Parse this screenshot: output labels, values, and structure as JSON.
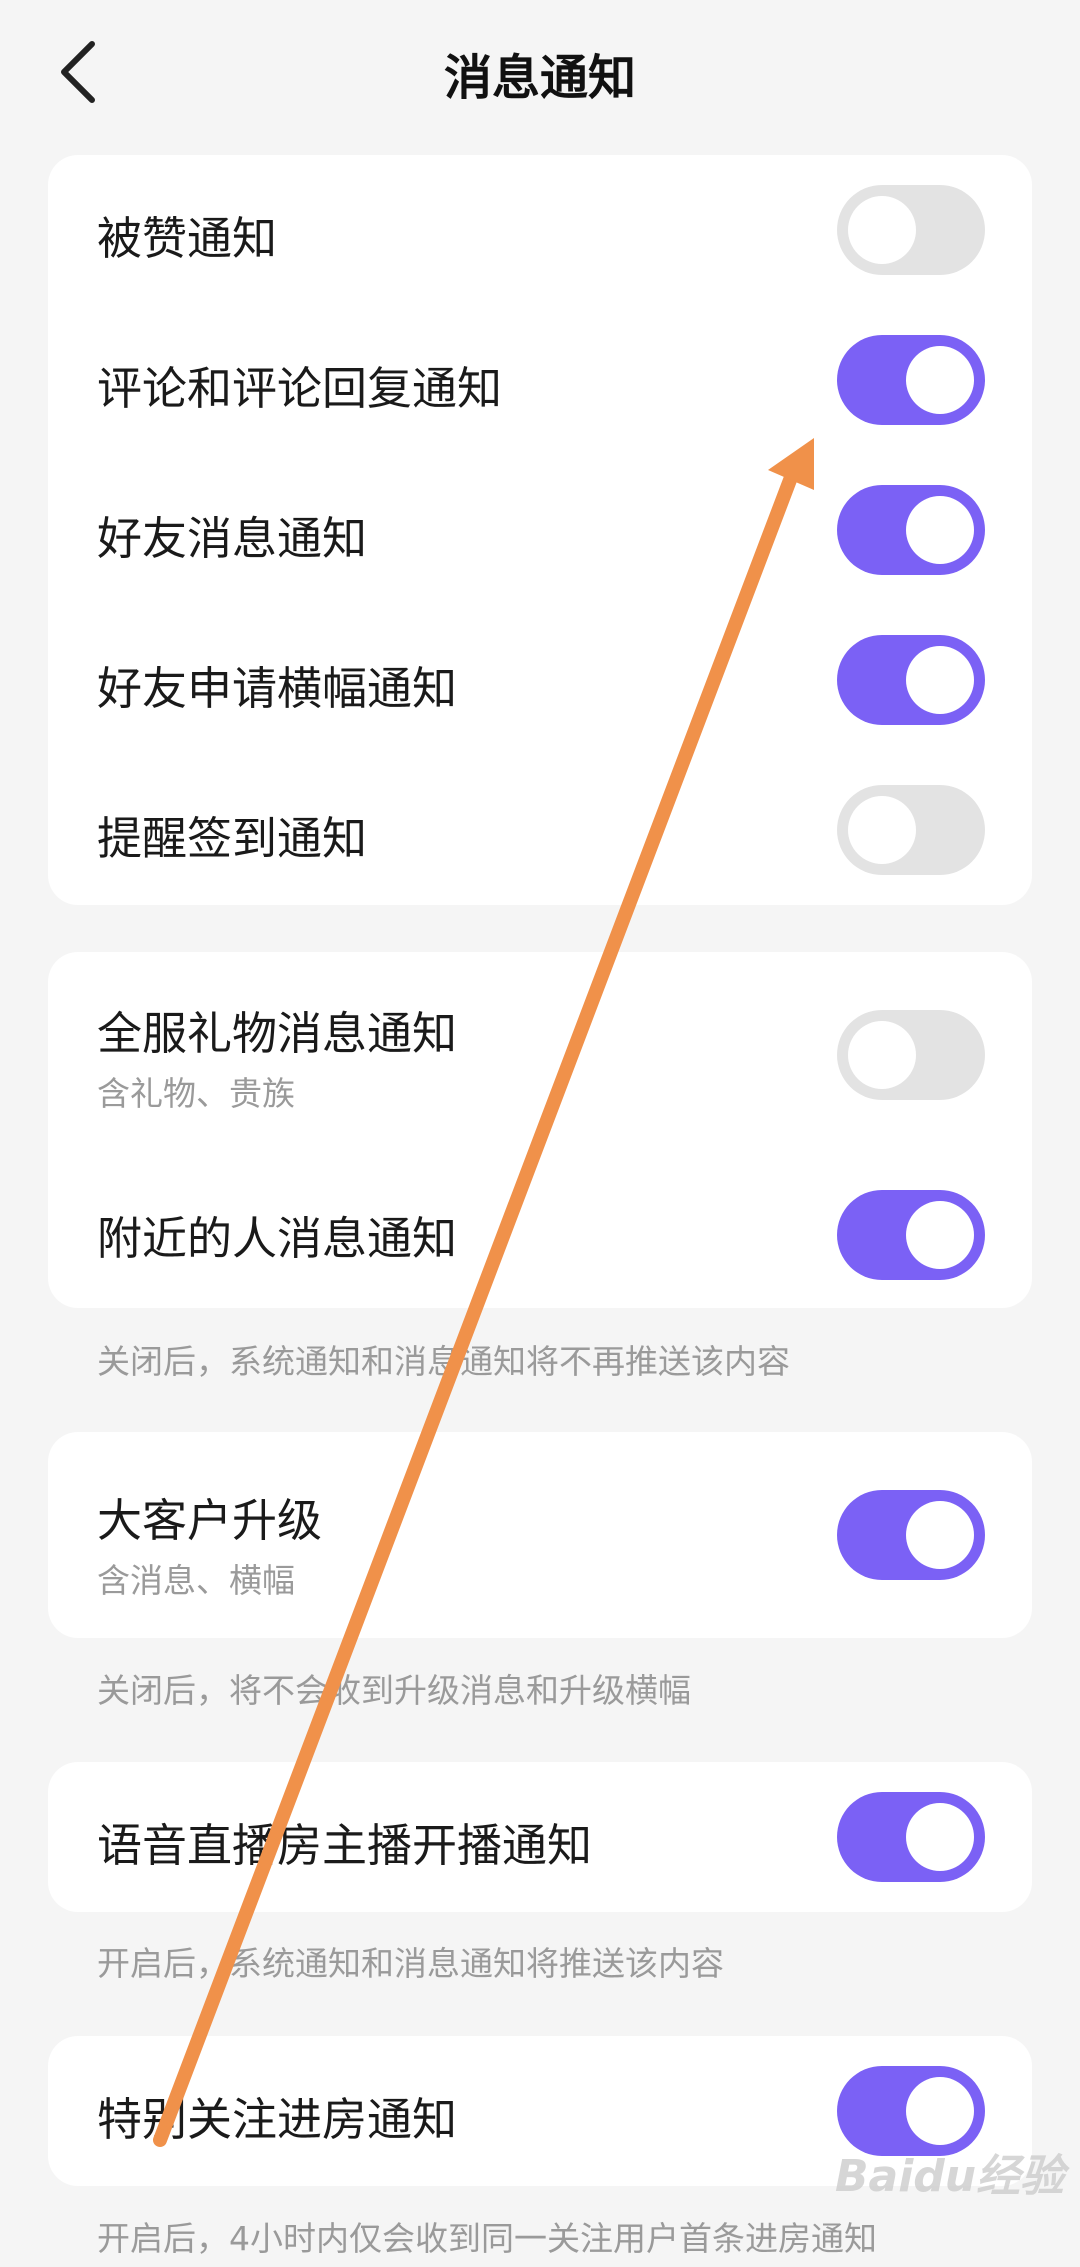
{
  "header": {
    "title": "消息通知"
  },
  "group1": {
    "items": [
      {
        "label": "被赞通知",
        "on": false
      },
      {
        "label": "评论和评论回复通知",
        "on": true
      },
      {
        "label": "好友消息通知",
        "on": true
      },
      {
        "label": "好友申请横幅通知",
        "on": true
      },
      {
        "label": "提醒签到通知",
        "on": false
      }
    ]
  },
  "group2": {
    "items": [
      {
        "label": "全服礼物消息通知",
        "sub": "含礼物、贵族",
        "on": false
      },
      {
        "label": "附近的人消息通知",
        "on": true
      }
    ],
    "note": "关闭后，系统通知和消息通知将不再推送该内容"
  },
  "group3": {
    "items": [
      {
        "label": "大客户升级",
        "sub": "含消息、横幅",
        "on": true
      }
    ],
    "note": "关闭后，将不会收到升级消息和升级横幅"
  },
  "group4": {
    "items": [
      {
        "label": "语音直播房主播开播通知",
        "on": true
      }
    ],
    "note": "开启后，系统通知和消息通知将推送该内容"
  },
  "group5": {
    "items": [
      {
        "label": "特别关注进房通知",
        "on": true
      }
    ],
    "note": "开启后，4小时内仅会收到同一关注用户首条进房通知"
  },
  "watermark": "Baidu经验",
  "colors": {
    "accent": "#7b61f5",
    "toggle_off": "#e3e3e3",
    "annotation_arrow": "#f0914a"
  }
}
